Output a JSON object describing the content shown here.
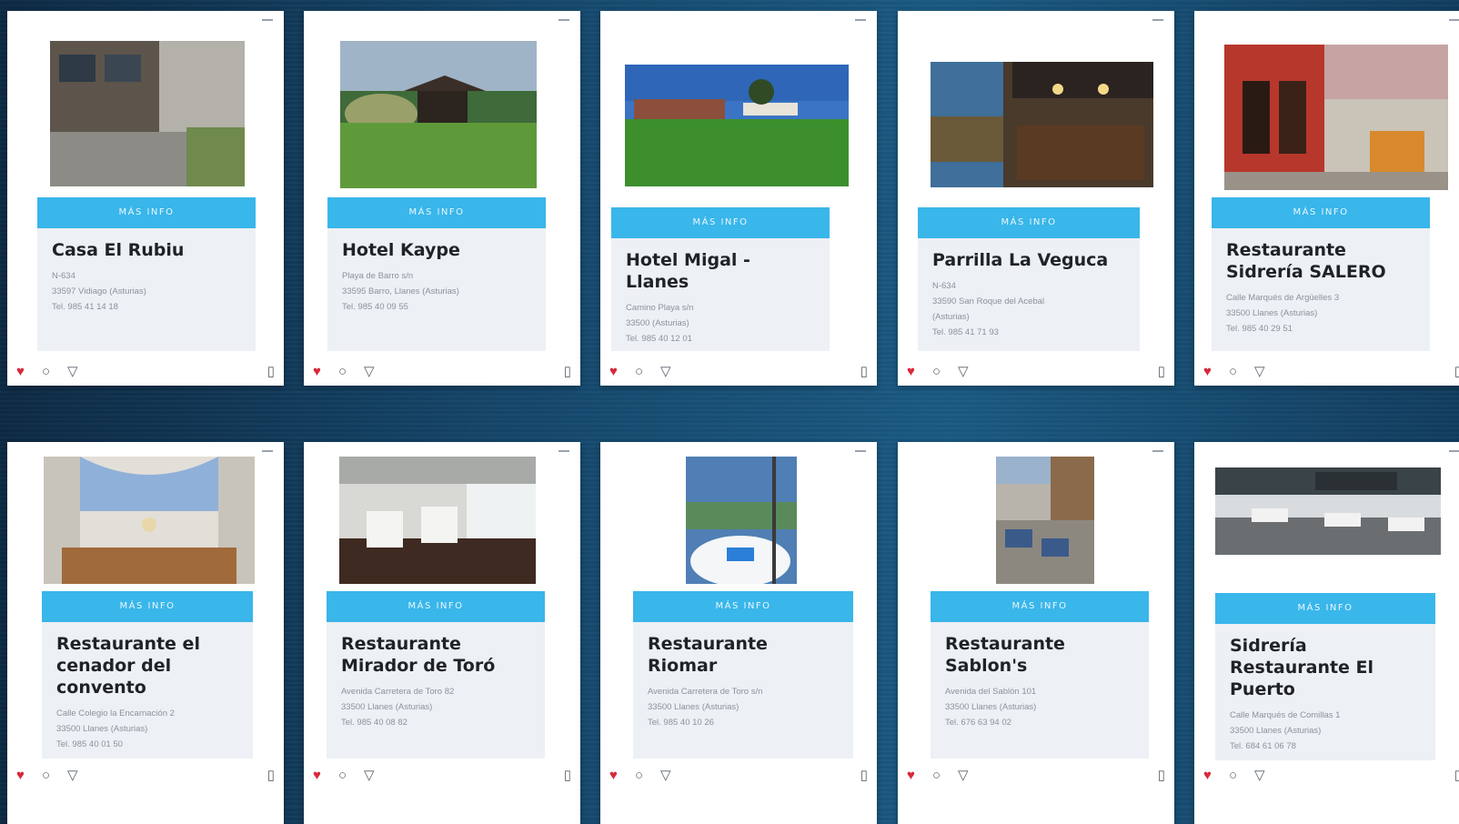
{
  "button_label": "MÁS INFO",
  "colors": {
    "accent": "#39b6ea",
    "like": "#d8283b",
    "panel": "#edf0f4"
  },
  "icons": {
    "like": "heart-icon",
    "comment": "comment-icon",
    "share": "share-icon",
    "save": "bookmark-icon"
  },
  "cards": [
    {
      "title": "Casa El Rubiu",
      "lines": [
        "N-634",
        "33597 Vidiago (Asturias)",
        "Tel. 985 41 14 18"
      ]
    },
    {
      "title": "Hotel Kaype",
      "lines": [
        "Playa de Barro s/n",
        "33595 Barro, Llanes (Asturias)",
        "Tel. 985 40 09 55"
      ]
    },
    {
      "title": "Hotel Migal - Llanes",
      "lines": [
        "Camino Playa s/n",
        "33500 (Asturias)",
        "Tel. 985 40 12 01"
      ]
    },
    {
      "title": "Parrilla La Veguca",
      "lines": [
        "N-634",
        "33590 San Roque del Acebal",
        "(Asturias)",
        "Tel. 985 41 71 93"
      ]
    },
    {
      "title": "Restaurante Sidrería SALERO",
      "lines": [
        "Calle Marqués de Argüelles 3",
        "33500 Llanes (Asturias)",
        "Tel. 985 40 29 51"
      ]
    },
    {
      "title": "Restaurante el cenador del convento",
      "lines": [
        "Calle Colegio la Encarnación 2",
        "33500 Llanes (Asturias)",
        "Tel. 985 40 01 50"
      ]
    },
    {
      "title": "Restaurante Mirador de Toró",
      "lines": [
        "Avenida Carretera de Toro 82",
        "33500 Llanes (Asturias)",
        "Tel. 985 40 08 82"
      ]
    },
    {
      "title": "Restaurante Riomar",
      "lines": [
        "Avenida Carretera de Toro s/n",
        "33500 Llanes (Asturias)",
        "Tel. 985 40 10 26"
      ]
    },
    {
      "title": "Restaurante Sablon's",
      "lines": [
        "Avenida del Sablón 101",
        "33500 Llanes (Asturias)",
        "Tel. 676 63 94 02"
      ]
    },
    {
      "title": "Sidrería Restaurante El Puerto",
      "lines": [
        "Calle Marqués de Comillas 1",
        "33500 Llanes (Asturias)",
        "Tel. 684 61 06 78"
      ]
    }
  ]
}
